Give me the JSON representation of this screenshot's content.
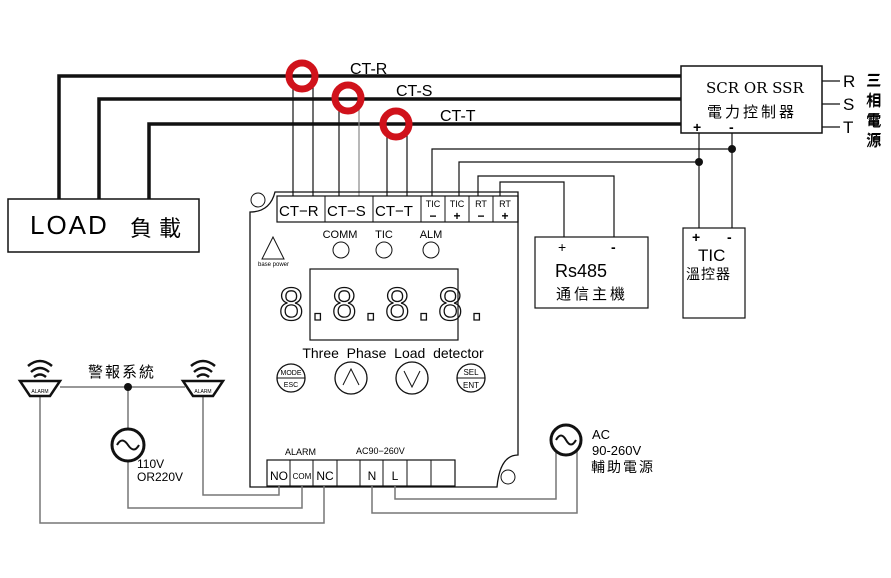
{
  "colors": {
    "ct_ring": "#d0121b",
    "wire": "#111111",
    "thin_wire": "#777777"
  },
  "load": {
    "label": "LOAD",
    "label_cn": "負 載"
  },
  "cts": [
    {
      "label": "CT-R"
    },
    {
      "label": "CT-S"
    },
    {
      "label": "CT-T"
    }
  ],
  "scr": {
    "line1": "SCR OR SSR",
    "line2": "電力控制器",
    "plus": "+",
    "minus": "-"
  },
  "phases": {
    "r": "R",
    "s": "S",
    "t": "T",
    "label": "三相電源",
    "c1": "三",
    "c2": "相",
    "c3": "電",
    "c4": "源"
  },
  "device": {
    "top_terminals": [
      {
        "a": "CT",
        "b": "R"
      },
      {
        "a": "CT",
        "b": "S"
      },
      {
        "a": "CT",
        "b": "T"
      }
    ],
    "tic_minus": {
      "a": "TIC",
      "b": "−"
    },
    "tic_plus": {
      "a": "TIC",
      "b": "+"
    },
    "rt_minus": {
      "a": "RT",
      "b": "−"
    },
    "rt_plus": {
      "a": "RT",
      "b": "+"
    },
    "base_power": "base power",
    "leds": {
      "comm": "COMM",
      "tic": "TIC",
      "alm": "ALM"
    },
    "display": "8.8.8.8.",
    "title": "Three  Phase  Load  detector",
    "buttons": {
      "mode": "MODE",
      "esc": "ESC",
      "sel": "SEL",
      "ent": "ENT",
      "up": "up-arrow",
      "down": "down-arrow"
    },
    "alarm_label": "ALARM",
    "ac_label": "AC90−260V",
    "bottom_terminals": [
      "NO",
      "COM",
      "NC",
      "",
      "N",
      "L",
      "",
      ""
    ]
  },
  "rs485": {
    "plus": "+",
    "minus": "-",
    "title": "Rs485",
    "subtitle": "通信主機"
  },
  "tic": {
    "plus": "+",
    "minus": "-",
    "title": "TIC",
    "subtitle": "溫控器"
  },
  "alarm_system": {
    "label": "警報系統",
    "siren_label": "ALARM",
    "voltage1": "110V",
    "voltage2": "OR220V"
  },
  "aux_power": {
    "line1": "AC",
    "line2": "90-260V",
    "line3": "輔助電源"
  }
}
